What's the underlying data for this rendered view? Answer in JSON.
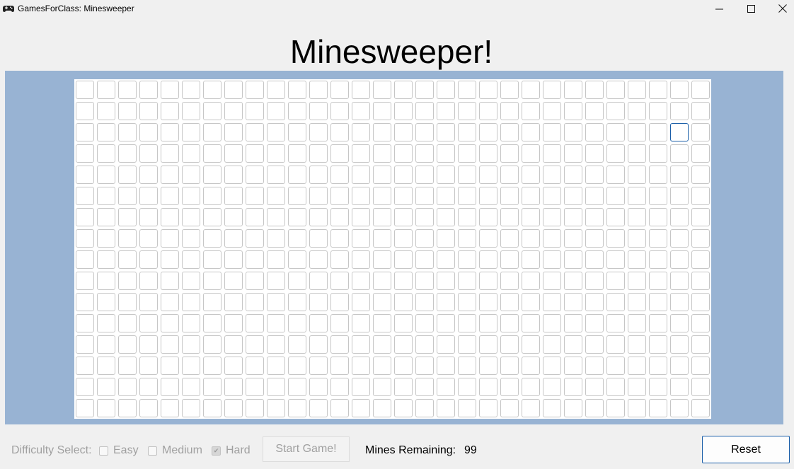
{
  "window": {
    "title": "GamesForClass: Minesweeper",
    "minimize_icon": "minimize-icon",
    "maximize_icon": "maximize-icon",
    "close_icon": "close-icon"
  },
  "game": {
    "heading": "Minesweeper!",
    "board": {
      "rows": 16,
      "columns": 30,
      "focused_cell": {
        "row": 3,
        "column": 29
      },
      "background_color": "#98b3d3"
    }
  },
  "controls": {
    "difficulty_label": "Difficulty Select:",
    "options": [
      {
        "label": "Easy",
        "checked": false
      },
      {
        "label": "Medium",
        "checked": false
      },
      {
        "label": "Hard",
        "checked": true
      }
    ],
    "start_label": "Start Game!",
    "mines_label": "Mines Remaining:",
    "mines_value": "99",
    "reset_label": "Reset"
  }
}
